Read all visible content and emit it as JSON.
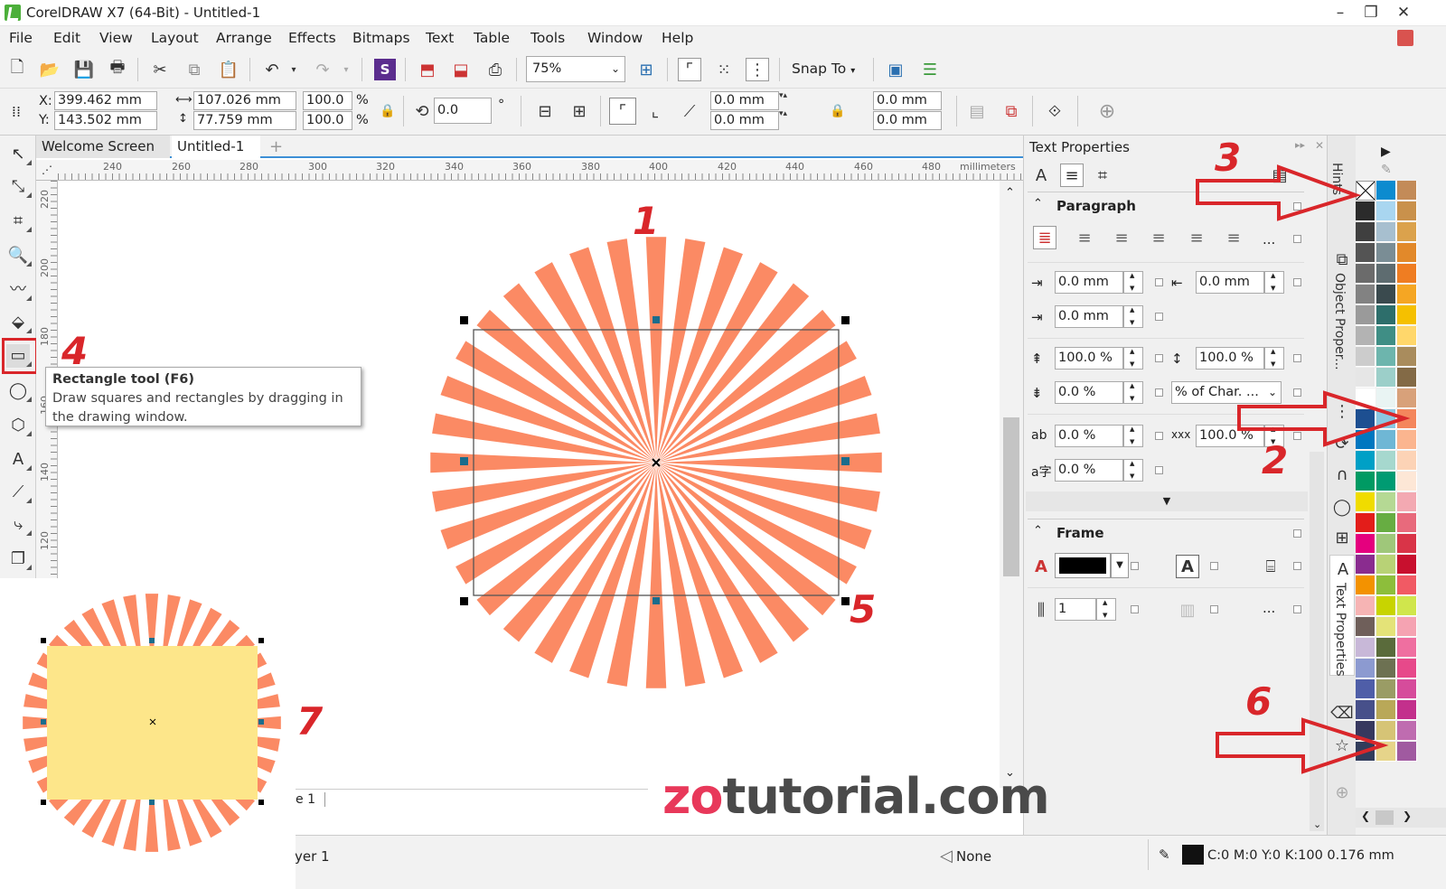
{
  "window": {
    "title": "CorelDRAW X7 (64-Bit) - Untitled-1",
    "btn_min": "–",
    "btn_restore": "❐",
    "btn_close": "✕"
  },
  "menu": [
    "File",
    "Edit",
    "View",
    "Layout",
    "Arrange",
    "Effects",
    "Bitmaps",
    "Text",
    "Table",
    "Tools",
    "Window",
    "Help"
  ],
  "toolbar": {
    "zoom": "75%",
    "snap_to": "Snap To"
  },
  "propbar": {
    "x_label": "X:",
    "x_value": "399.462 mm",
    "y_label": "Y:",
    "y_value": "143.502 mm",
    "width": "107.026 mm",
    "height": "77.759 mm",
    "scale_x": "100.0",
    "scale_y": "100.0",
    "pct": "%",
    "rotation": "0.0",
    "deg": "°",
    "corner_1": "0.0 mm",
    "corner_2": "0.0 mm",
    "corner_3": "0.0 mm",
    "corner_4": "0.0 mm"
  },
  "tabs": {
    "welcome": "Welcome Screen",
    "doc": "Untitled-1",
    "add": "+"
  },
  "ruler": {
    "unit": "millimeters",
    "h_ticks": [
      "240",
      "260",
      "280",
      "300",
      "320",
      "340",
      "360",
      "380",
      "400",
      "420",
      "440",
      "460",
      "480"
    ],
    "v_ticks": [
      "220",
      "200",
      "180",
      "160",
      "140",
      "120"
    ]
  },
  "tooltip": {
    "title": "Rectangle tool (F6)",
    "body": "Draw squares and rectangles by dragging in the drawing window."
  },
  "docker": {
    "title": "Text Properties",
    "paragraph": "Paragraph",
    "indent_first": "0.0 mm",
    "indent_right": "0.0 mm",
    "indent_left": "0.0 mm",
    "line_spacing": "100.0 %",
    "char_spacing_before": "100.0 %",
    "space_after": "0.0 %",
    "spacing_unit": "% of Char. ...",
    "char_spacing": "0.0 %",
    "word_spacing": "100.0 %",
    "lang_spacing": "0.0 %",
    "more": "...",
    "frame": "Frame",
    "columns": "1"
  },
  "docker_tabs": {
    "hints": "Hints",
    "object_props": "Object Proper...",
    "text_props": "Text Properties"
  },
  "palette": {
    "col1": [
      "#000000",
      "#2b2b2b",
      "#3f3f3f",
      "#545454",
      "#6b6b6b",
      "#828282",
      "#9a9a9a",
      "#b3b3b3",
      "#cccccc",
      "#e6e6e6",
      "#ffffff",
      "#1d4f91",
      "#0077c0",
      "#00a0c6",
      "#009a63",
      "#f0dc00",
      "#e31d1a",
      "#e5007e",
      "#8a2c8f",
      "#f39200",
      "#f6b4b4",
      "#6f5f5a",
      "#c8b8d8",
      "#8c9ad0",
      "#4f5ea8",
      "#47508a",
      "#37385e",
      "#313c5b"
    ],
    "col2": [
      "#0c8bcf",
      "#a9d6f0",
      "#a7bfcf",
      "#7a8d95",
      "#5e6c70",
      "#3a4a4e",
      "#2d6e6b",
      "#3f8e85",
      "#6db5ad",
      "#9ccfc9",
      "#e9f4f3",
      "#8ac7e1",
      "#6fb7d5",
      "#a6d8ce",
      "#009b72",
      "#b5d994",
      "#67ad42",
      "#9fc77a",
      "#b8d276",
      "#8dbe3b",
      "#c8d400",
      "#e4e378",
      "#5a6b3b",
      "#6d7152",
      "#9a9c65",
      "#b9a858",
      "#d6c476",
      "#e6d48a"
    ],
    "col3": [
      "#c38b58",
      "#c9914b",
      "#dba24c",
      "#e2892a",
      "#ef7d22",
      "#f5a623",
      "#f5c000",
      "#ffd76b",
      "#a98c5d",
      "#836a46",
      "#d8a17a",
      "#f4865c",
      "#fbb58f",
      "#fcd3b6",
      "#fde7d6",
      "#f3a9b2",
      "#e86a7c",
      "#d93448",
      "#c8102e",
      "#f15a64",
      "#d0e64c",
      "#f5a3b2",
      "#ef6fa0",
      "#e7498a",
      "#d64c9b",
      "#c3308c",
      "#bf6cb0",
      "#a05aa0"
    ]
  },
  "annotations": [
    "1",
    "2",
    "3",
    "4",
    "5",
    "6",
    "7"
  ],
  "watermark": {
    "zo": "zo",
    "rest": "tutorial.com"
  },
  "pagebar": {
    "page": "e 1"
  },
  "status": {
    "layer": "yer 1",
    "fill": "None",
    "outline": "C:0 M:0 Y:0 K:100  0.176 mm"
  },
  "colors": {
    "burst": "#fb8a64",
    "rect_fill": "#fde68a",
    "accent": "#3c8fd6",
    "annotation": "#d9262a"
  }
}
